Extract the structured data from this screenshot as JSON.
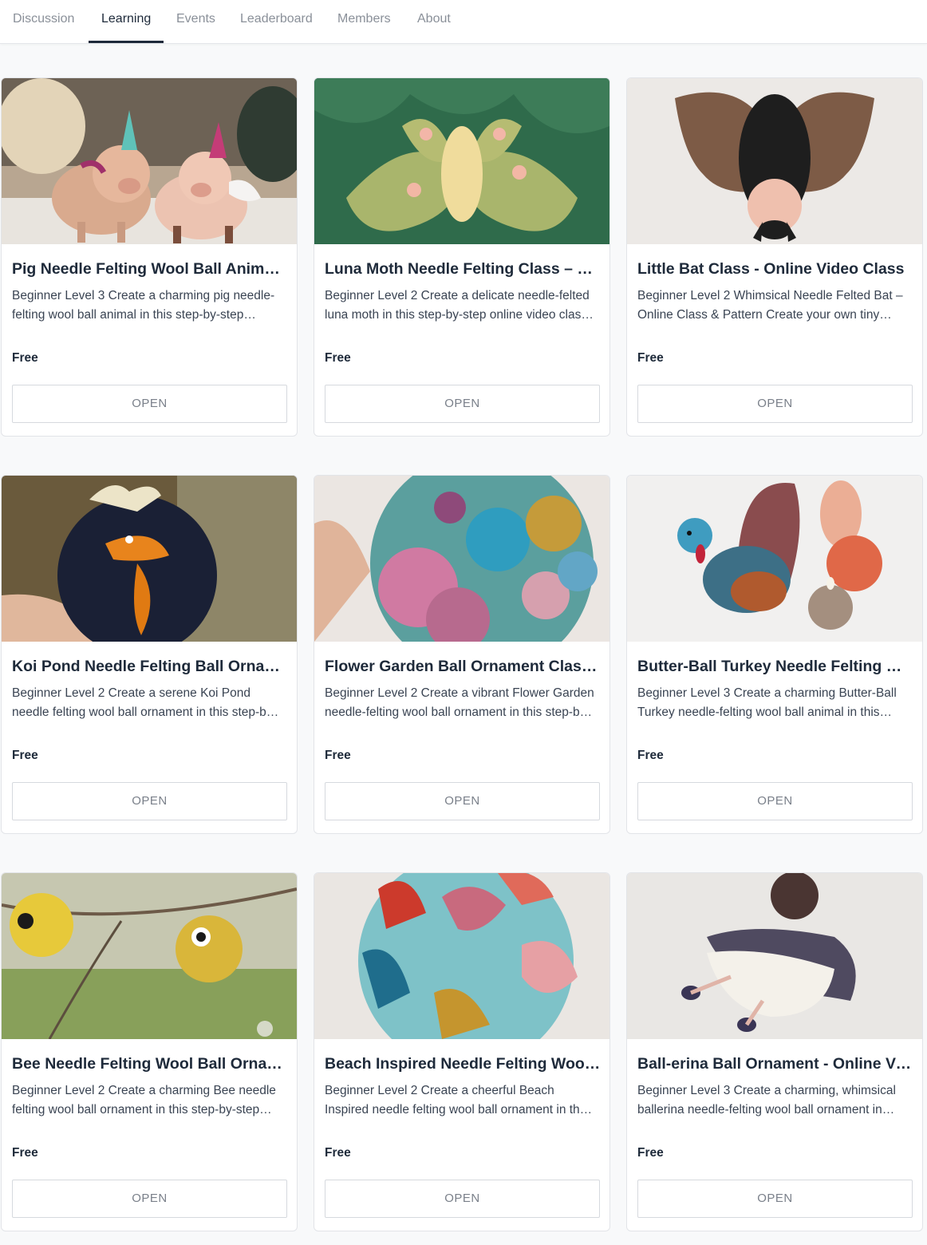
{
  "nav": {
    "tabs": [
      {
        "label": "Discussion",
        "active": false
      },
      {
        "label": "Learning",
        "active": true
      },
      {
        "label": "Events",
        "active": false
      },
      {
        "label": "Leaderboard",
        "active": false
      },
      {
        "label": "Members",
        "active": false
      },
      {
        "label": "About",
        "active": false
      }
    ]
  },
  "colors": {
    "accent": "#1e2a3a",
    "muted": "#8a9099",
    "background": "#f8f9fa",
    "card": "#ffffff"
  },
  "courses": [
    {
      "title": "Pig Needle Felting Wool Ball Animal ...",
      "description": "Beginner Level 3 Create a charming pig needle-felting wool ball animal in this step-by-step…",
      "price": "Free",
      "button": "OPEN",
      "image": "felted-pigs-with-unicorn-horns"
    },
    {
      "title": "Luna Moth Needle Felting Class – W...",
      "description": "Beginner Level 2 Create a delicate needle-felted luna moth in this step-by-step online video clas…",
      "price": "Free",
      "button": "OPEN",
      "image": "felted-luna-moth-on-green-wool"
    },
    {
      "title": "Little Bat Class - Online Video Class",
      "description": "Beginner Level 2 Whimsical Needle Felted Bat – Online Class & Pattern Create your own tiny…",
      "price": "Free",
      "button": "OPEN",
      "image": "felted-hanging-bat"
    },
    {
      "title": "Koi Pond Needle Felting Ball Orname...",
      "description": "Beginner Level 2 Create a serene Koi Pond needle felting wool ball ornament in this step-b…",
      "price": "Free",
      "button": "OPEN",
      "image": "koi-pond-felted-ball"
    },
    {
      "title": "Flower Garden Ball Ornament Class ...",
      "description": "Beginner Level 2 Create a vibrant Flower Garden needle-felting wool ball ornament in this step-b…",
      "price": "Free",
      "button": "OPEN",
      "image": "flower-garden-felted-ball"
    },
    {
      "title": "Butter-Ball Turkey Needle Felting Wo...",
      "description": "Beginner Level 3 Create a charming Butter-Ball Turkey needle-felting wool ball animal in this…",
      "price": "Free",
      "button": "OPEN",
      "image": "felted-turkey-with-pumpkins"
    },
    {
      "title": "Bee Needle Felting Wool Ball Ornam...",
      "description": "Beginner Level 2 Create a charming Bee needle felting wool ball ornament in this step-by-step…",
      "price": "Free",
      "button": "OPEN",
      "image": "felted-bee-balls-in-tree"
    },
    {
      "title": "Beach Inspired Needle Felting Wool ...",
      "description": "Beginner Level 2 Create a cheerful Beach Inspired needle felting wool ball ornament in th…",
      "price": "Free",
      "button": "OPEN",
      "image": "beach-patchwork-felted-ball"
    },
    {
      "title": "Ball-erina Ball Ornament - Online Vid...",
      "description": "Beginner Level 3 Create a charming, whimsical ballerina needle-felting wool ball ornament in…",
      "price": "Free",
      "button": "OPEN",
      "image": "felted-ballerina-ornament"
    }
  ]
}
